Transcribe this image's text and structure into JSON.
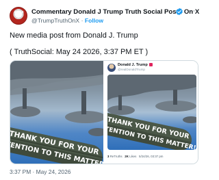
{
  "post": {
    "author_name": "Commentary Donald J Trump Truth Social Posts On X",
    "handle": "@TrumpTruthOnX",
    "separator": "·",
    "follow_label": "Follow",
    "more_glyph": "···",
    "text": "New media post from Donald J. Trump",
    "timestamp_line": "( TruthSocial: May 24 2026, 3:37 PM ET )",
    "meta": "3:37 PM · May 24, 2026"
  },
  "media": {
    "bomb_text_line1": "THANK YOU FOR YOUR",
    "bomb_text_line2": "ATTENTION TO THIS MATTER!"
  },
  "embedded_post": {
    "name": "Donald J. Trump",
    "handle": "@realDonaldTrump",
    "retruths_count": "3",
    "retruths_label": "ReTruths",
    "likes_count": "2K",
    "likes_label": "Likes",
    "date": "5/24/26, 03:37 pm"
  },
  "colors": {
    "accent": "#1d9bf0",
    "text": "#0f1419",
    "secondary": "#536471",
    "sky": "#4f86c6",
    "bomb_body": "#3f4a3c"
  },
  "icons": {
    "verified": "verified-badge-icon",
    "more": "more-options-icon"
  }
}
